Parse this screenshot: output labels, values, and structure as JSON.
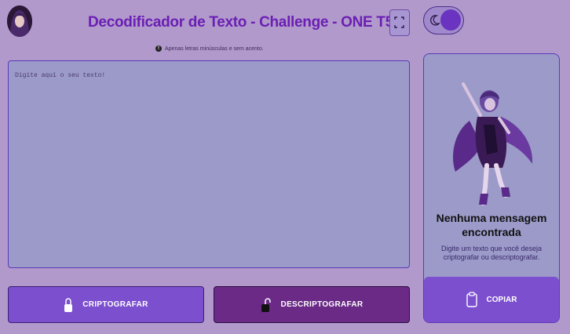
{
  "header": {
    "title": "Decodificador de Texto - Challenge - ONE T5",
    "hint": "Apenas letras minúsculas e sem acento."
  },
  "input": {
    "placeholder": "Digite aqui o seu texto!"
  },
  "buttons": {
    "encrypt_label": "CRIPTOGRAFAR",
    "decrypt_label": "DESCRIPTOGRAFAR",
    "copy_label": "COPIAR"
  },
  "output": {
    "title": "Nenhuma mensagem encontrada",
    "subtitle": "Digite um texto que você deseja criptografar ou descriptografar."
  },
  "icons": {
    "fullscreen": "fullscreen-icon",
    "theme": "moon-icon",
    "info": "info-icon",
    "lock": "lock-icon",
    "unlock": "unlock-icon",
    "clipboard": "clipboard-icon"
  },
  "colors": {
    "background": "#b299cc",
    "title": "#6a1fb3",
    "primary_button": "#7c4fcf",
    "secondary_button": "#6a2a86",
    "panel": "#9b9ac9"
  }
}
